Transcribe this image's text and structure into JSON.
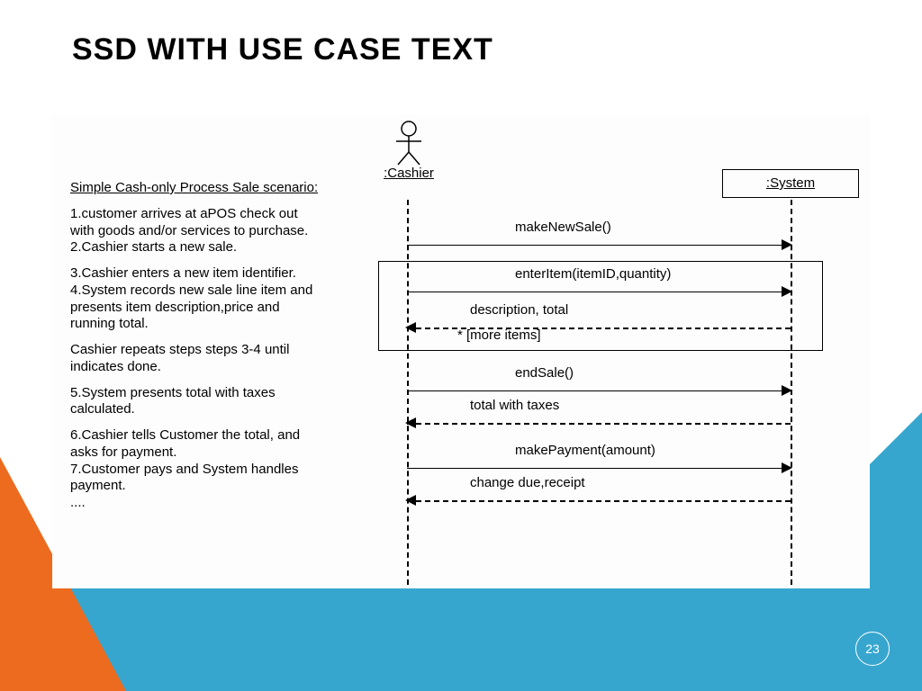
{
  "title": "SSD WITH USE CASE TEXT",
  "page_number": "23",
  "usecase": {
    "heading": "Simple Cash-only Process Sale scenario:",
    "p1": "1.customer arrives at aPOS check out with goods and/or services to purchase.\n2.Cashier starts a new sale.",
    "p2": "3.Cashier enters a new item identifier.\n4.System records new sale line item and presents item description,price and running total.",
    "p3": "Cashier repeats steps steps 3-4 until indicates done.",
    "p4": "5.System presents total with taxes calculated.",
    "p5": "6.Cashier tells Customer the total, and asks for payment.\n7.Customer pays and System handles payment.\n...."
  },
  "actor_label": ":Cashier",
  "system_label": ":System",
  "messages": {
    "m1": "makeNewSale()",
    "m2": "enterItem(itemID,quantity)",
    "r2": "description, total",
    "loop_guard": "* [more items]",
    "m3": "endSale()",
    "r3": "total with taxes",
    "m4": "makePayment(amount)",
    "r4": "change due,receipt"
  }
}
